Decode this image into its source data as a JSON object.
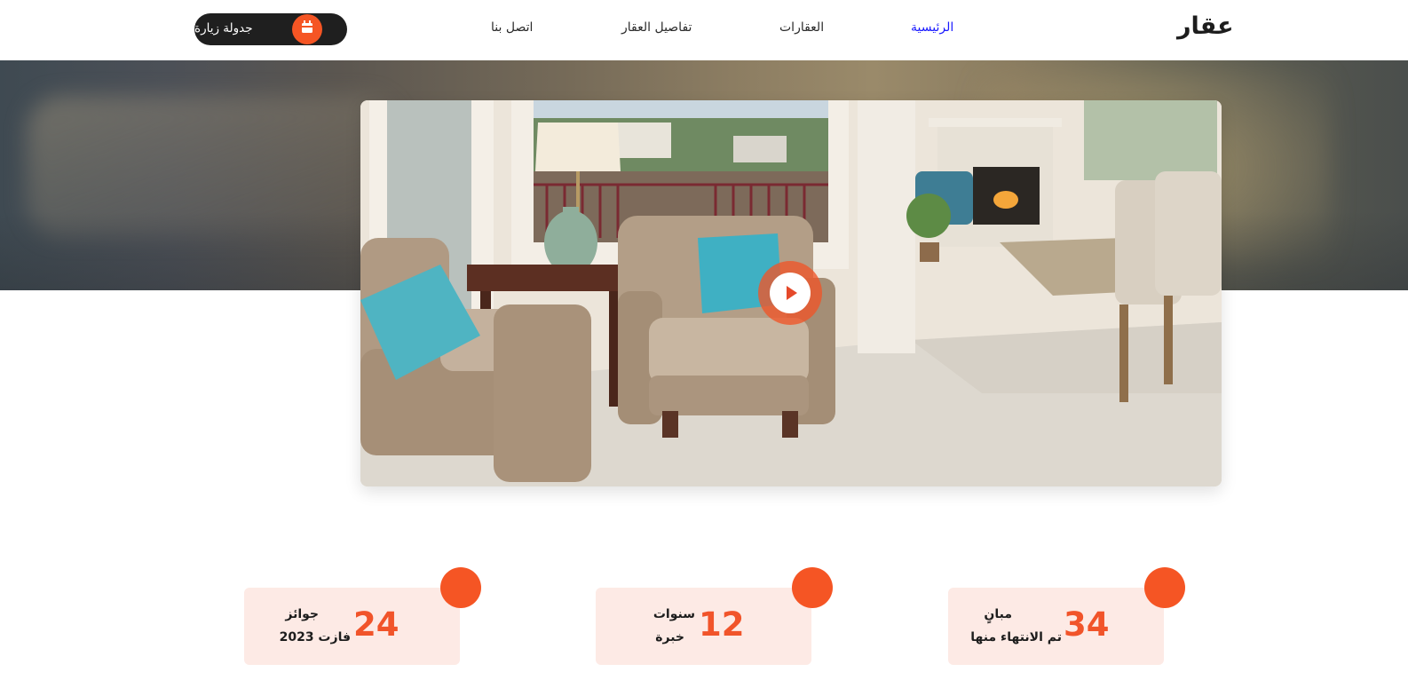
{
  "header": {
    "logo": "عقار",
    "nav": [
      {
        "label": "الرئيسية",
        "active": true
      },
      {
        "label": "العقارات",
        "active": false
      },
      {
        "label": "تفاصيل العقار",
        "active": false
      },
      {
        "label": "اتصل بنا",
        "active": false
      }
    ],
    "cta_label": "جدولة زيارة",
    "cta_icon": "calendar-icon"
  },
  "video": {
    "play_icon": "play-icon"
  },
  "stats": [
    {
      "number": "34",
      "line1": "مبانٍ",
      "line2": "تم الانتهاء منها"
    },
    {
      "number": "12",
      "line1": "سنوات",
      "line2": "خبرة"
    },
    {
      "number": "24",
      "line1": "جوائز",
      "line2": "فازت 2023"
    }
  ],
  "colors": {
    "accent": "#f55524",
    "nav_active": "#1a1aff",
    "stat_bg": "#fdeae5",
    "cta_bg": "#1f1f1f"
  }
}
